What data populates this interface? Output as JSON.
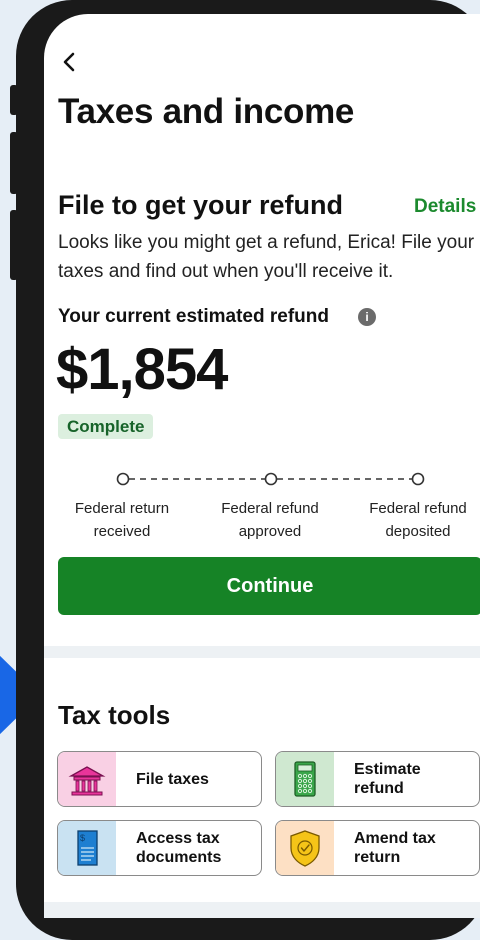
{
  "header": {
    "back_icon": "chevron-left-icon",
    "title": "Taxes and income"
  },
  "refund": {
    "heading": "File to get your refund",
    "details_link": "Details",
    "description": "Looks like you might get a refund, Erica! File your taxes and find out when you'll receive it.",
    "estimate_label": "Your current estimated refund",
    "info_icon": "info-icon",
    "amount": "$1,854",
    "status_badge": "Complete",
    "stages": [
      {
        "line1": "Federal return",
        "line2": "received"
      },
      {
        "line1": "Federal refund",
        "line2": "approved"
      },
      {
        "line1": "Federal refund",
        "line2": "deposited"
      }
    ],
    "continue_label": "Continue"
  },
  "tax_tools": {
    "heading": "Tax tools",
    "items": [
      {
        "line1": "File taxes",
        "line2": "",
        "icon": "bank-icon",
        "icon_bg": "#f9d0e4"
      },
      {
        "line1": "Estimate",
        "line2": "refund",
        "icon": "calculator-icon",
        "icon_bg": "#cfe8d0"
      },
      {
        "line1": "Access tax",
        "line2": "documents",
        "icon": "document-icon",
        "icon_bg": "#c9e2f2"
      },
      {
        "line1": "Amend tax",
        "line2": "return",
        "icon": "shield-check-icon",
        "icon_bg": "#fde0c4"
      }
    ]
  },
  "colors": {
    "accent_green": "#168326",
    "link_green": "#1c8a2e",
    "badge_bg": "#dcefdf",
    "badge_text": "#17632a"
  }
}
